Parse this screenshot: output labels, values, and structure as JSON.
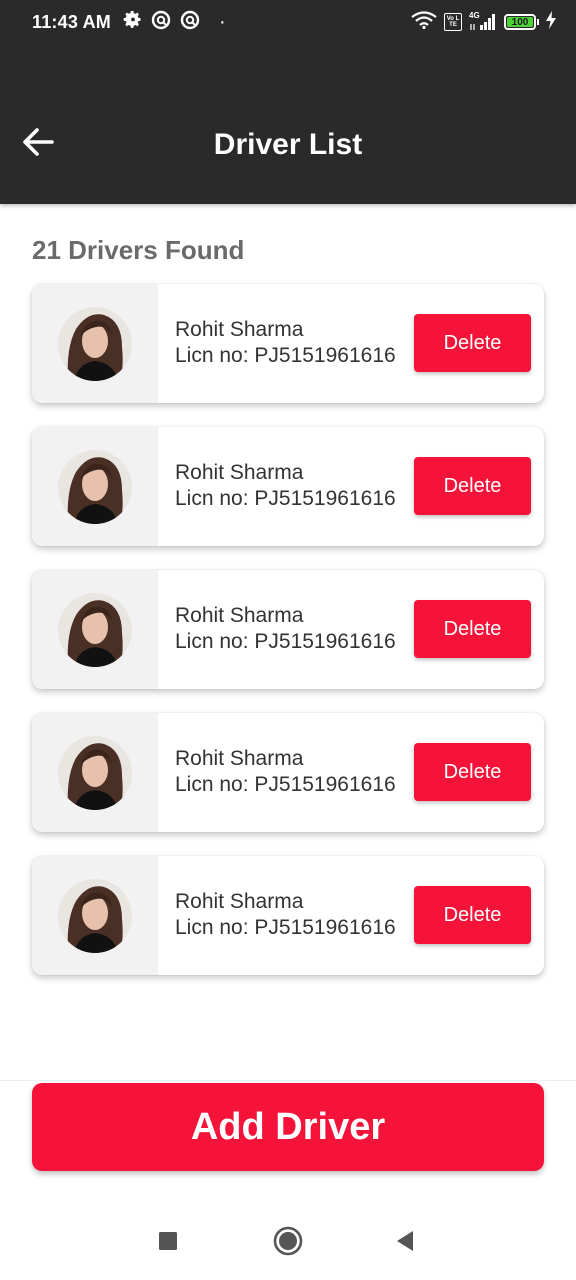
{
  "status_bar": {
    "time": "11:43 AM",
    "dot": "·",
    "volte_label": "Vo LTE",
    "network_label": "4G",
    "battery_level": "100",
    "icons": [
      "settings-gear-icon",
      "circle-notification-icon",
      "circle-notification-icon",
      "wifi-icon",
      "volte-icon",
      "signal-icon",
      "battery-icon",
      "charging-bolt-icon"
    ]
  },
  "header": {
    "title": "Driver List",
    "back_icon": "back-arrow-icon"
  },
  "main": {
    "count_label": "21 Drivers Found",
    "drivers": [
      {
        "name": "Rohit Sharma",
        "license": "Licn no: PJ5151961616",
        "delete_label": "Delete"
      },
      {
        "name": "Rohit Sharma",
        "license": "Licn no: PJ5151961616",
        "delete_label": "Delete"
      },
      {
        "name": "Rohit Sharma",
        "license": "Licn no: PJ5151961616",
        "delete_label": "Delete"
      },
      {
        "name": "Rohit Sharma",
        "license": "Licn no: PJ5151961616",
        "delete_label": "Delete"
      },
      {
        "name": "Rohit Sharma",
        "license": "Licn no: PJ5151961616",
        "delete_label": "Delete"
      }
    ]
  },
  "footer": {
    "add_driver_label": "Add Driver"
  },
  "nav_bar": {
    "icons": [
      "recents-square-icon",
      "home-circle-icon",
      "back-triangle-icon"
    ]
  },
  "colors": {
    "app_bar": "#2a2a2a",
    "accent": "#f5133a",
    "muted_text": "#6a6a6a",
    "body_text": "#333333",
    "avatar_panel": "#f2f2f2"
  }
}
